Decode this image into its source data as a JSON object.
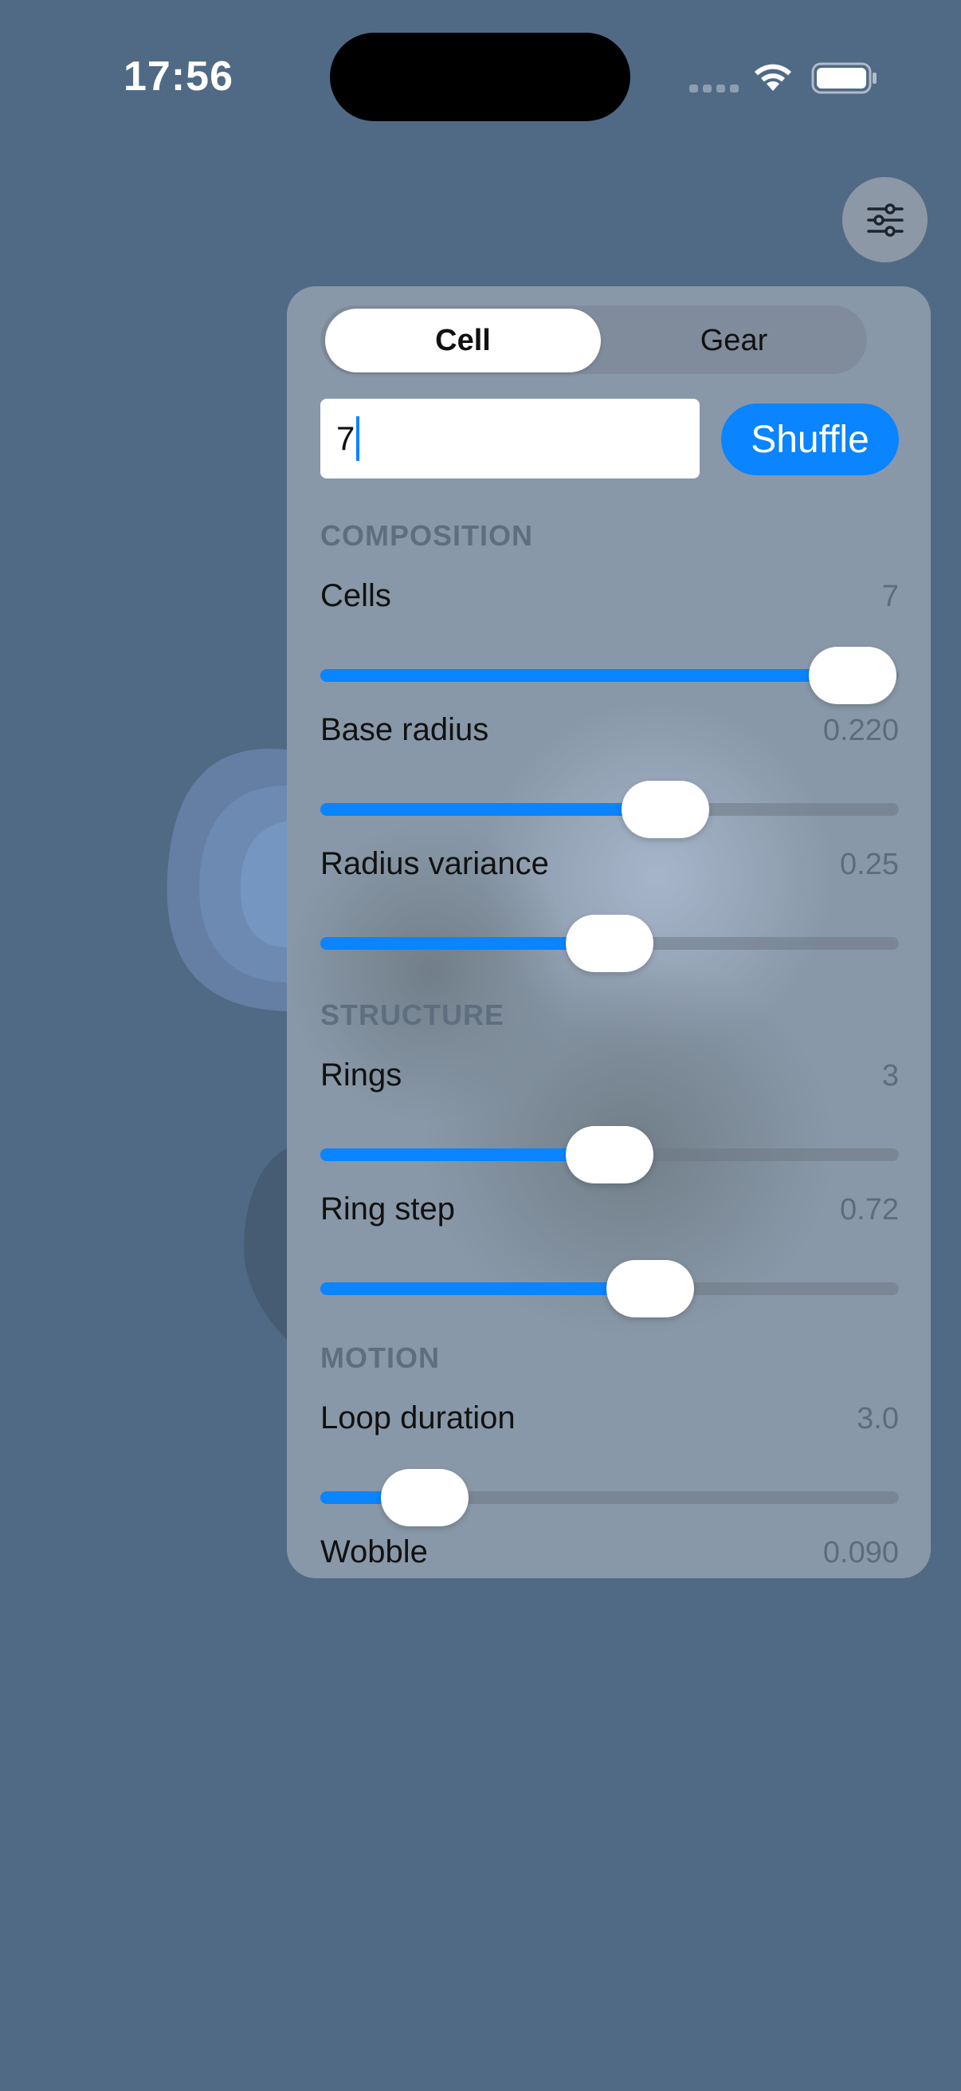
{
  "status_bar": {
    "time": "17:56"
  },
  "colors": {
    "accent": "#0a84ff",
    "background": "#506a85",
    "panel": "#8998a8"
  },
  "settings_button": {
    "icon": "sliders-icon"
  },
  "panel": {
    "tabs": [
      {
        "label": "Cell",
        "active": true
      },
      {
        "label": "Gear",
        "active": false
      }
    ],
    "seed_value": "7",
    "shuffle_label": "Shuffle",
    "sections": [
      {
        "title": "COMPOSITION",
        "rows": [
          {
            "label": "Cells",
            "value": "7",
            "fraction": 0.92
          },
          {
            "label": "Base radius",
            "value": "0.220",
            "fraction": 0.597
          },
          {
            "label": "Radius variance",
            "value": "0.25",
            "fraction": 0.5
          }
        ]
      },
      {
        "title": "STRUCTURE",
        "rows": [
          {
            "label": "Rings",
            "value": "3",
            "fraction": 0.5
          },
          {
            "label": "Ring step",
            "value": "0.72",
            "fraction": 0.57
          }
        ]
      },
      {
        "title": "MOTION",
        "rows": [
          {
            "label": "Loop duration",
            "value": "3.0",
            "fraction": 0.18
          },
          {
            "label": "Wobble",
            "value": "0.090"
          }
        ]
      }
    ]
  }
}
